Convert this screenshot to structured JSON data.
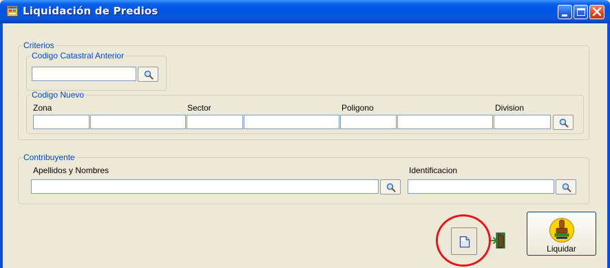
{
  "window": {
    "title": "Liquidación de Predios",
    "icons": {
      "app": "form-window-icon",
      "minimize": "minimize-icon",
      "maximize": "maximize-icon",
      "close": "close-icon"
    }
  },
  "criterios": {
    "legend": "Criterios",
    "codigo_anterior": {
      "legend": "Codigo Catastral Anterior",
      "value": ""
    },
    "codigo_nuevo": {
      "legend": "Codigo Nuevo",
      "labels": {
        "zona": "Zona",
        "sector": "Sector",
        "poligono": "Poligono",
        "division": "Division"
      },
      "values": [
        "",
        "",
        "",
        "",
        "",
        "",
        "",
        ""
      ]
    }
  },
  "contribuyente": {
    "legend": "Contribuyente",
    "apellidos_label": "Apellidos y Nombres",
    "apellidos_value": "",
    "identificacion_label": "Identificacion",
    "identificacion_value": ""
  },
  "actions": {
    "new_icon": "new-document-icon",
    "exit_icon": "exit-door-icon",
    "liquidar_label": "Liquidar",
    "liquidar_icon": "stamp-icon",
    "search_icon": "magnifier-icon"
  },
  "colors": {
    "titlebar": "#0054E3",
    "form_bg": "#ECE9D8",
    "legend_text": "#0046D5",
    "highlight": "#E8141B"
  }
}
